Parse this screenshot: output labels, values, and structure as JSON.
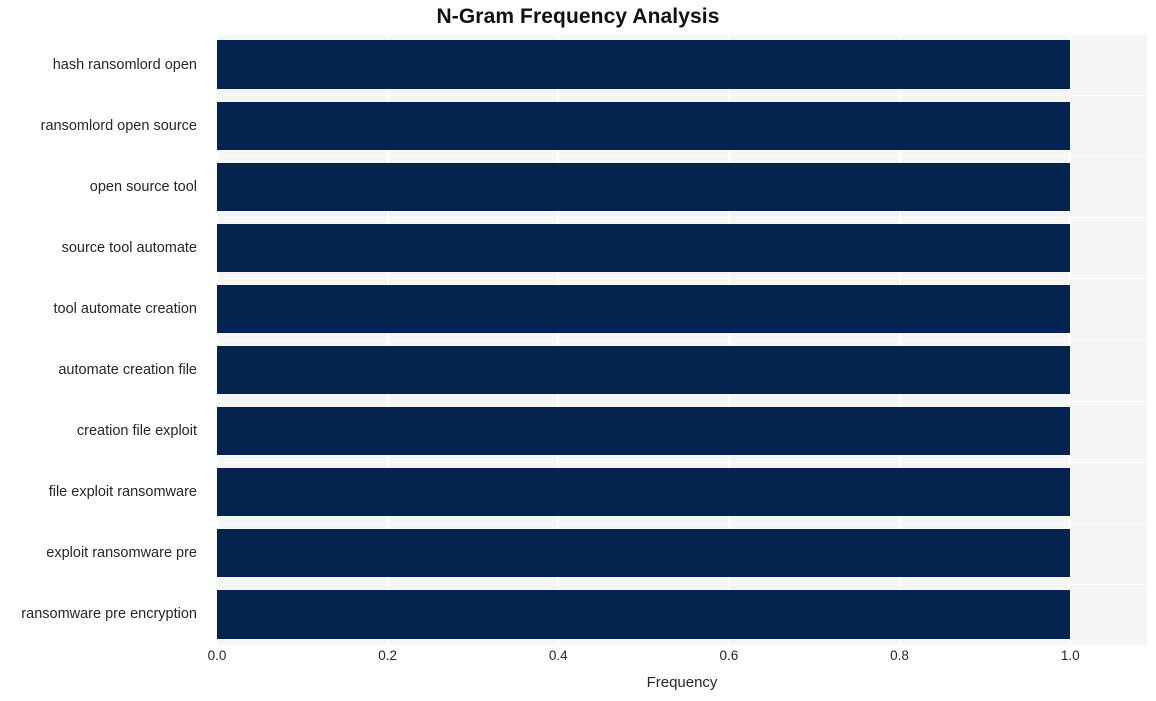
{
  "chart_data": {
    "type": "bar",
    "orientation": "horizontal",
    "title": "N-Gram Frequency Analysis",
    "xlabel": "Frequency",
    "ylabel": "",
    "categories": [
      "hash ransomlord open",
      "ransomlord open source",
      "open source tool",
      "source tool automate",
      "tool automate creation",
      "automate creation file",
      "creation file exploit",
      "file exploit ransomware",
      "exploit ransomware pre",
      "ransomware pre encryption"
    ],
    "values": [
      1.0,
      1.0,
      1.0,
      1.0,
      1.0,
      1.0,
      1.0,
      1.0,
      1.0,
      1.0
    ],
    "xlim": [
      0.0,
      1.09
    ],
    "xticks": [
      0.0,
      0.2,
      0.4,
      0.6,
      0.8,
      1.0
    ],
    "xtick_labels": [
      "0.0",
      "0.2",
      "0.4",
      "0.6",
      "0.8",
      "1.0"
    ],
    "grid": true,
    "grid_axis": "both",
    "legend": null,
    "bar_color": "#04244f",
    "plot_background": "#f5f5f5",
    "gridline_color": "#ffffff",
    "figure_background": "#ffffff",
    "text_color": "#262626",
    "title_color": "#111111"
  }
}
